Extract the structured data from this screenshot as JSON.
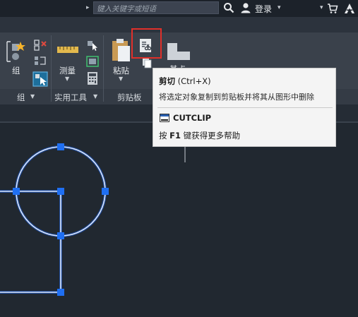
{
  "titlebar": {
    "search_placeholder": "键入关键字或短语",
    "login_label": "登录"
  },
  "ribbon": {
    "group_panel": {
      "tool_label": "组",
      "panel_title": "组"
    },
    "utilities_panel": {
      "tool_label": "测量",
      "panel_title": "实用工具"
    },
    "clipboard_panel": {
      "tool_label": "粘贴",
      "panel_title": "剪贴板"
    },
    "base_label": "基点"
  },
  "tooltip": {
    "title": "剪切",
    "shortcut": "(Ctrl+X)",
    "description": "将选定对象复制到剪贴板并将其从图形中删除",
    "command": "CUTCLIP",
    "help_prefix": "按",
    "help_key": "F1",
    "help_suffix": "键获得更多帮助"
  },
  "colors": {
    "canvas_bg": "#212830",
    "selection_line": "#cfe3ff",
    "grip": "#1f6ff2",
    "highlight_box": "#e0302a"
  }
}
